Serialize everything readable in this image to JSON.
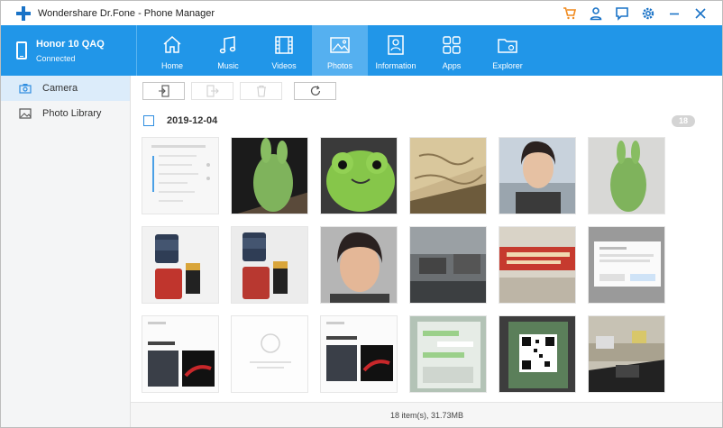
{
  "app": {
    "title": "Wondershare Dr.Fone - Phone Manager"
  },
  "title_icons": [
    "cart-icon",
    "user-icon",
    "feedback-icon",
    "settings-icon",
    "minimize-icon",
    "close-icon"
  ],
  "device": {
    "name": "Honor 10 QAQ",
    "status": "Connected"
  },
  "tabs": [
    {
      "label": "Home",
      "icon": "home-icon",
      "active": false
    },
    {
      "label": "Music",
      "icon": "music-icon",
      "active": false
    },
    {
      "label": "Videos",
      "icon": "film-icon",
      "active": false
    },
    {
      "label": "Photos",
      "icon": "photo-icon",
      "active": true
    },
    {
      "label": "Information",
      "icon": "contact-card-icon",
      "active": false
    },
    {
      "label": "Apps",
      "icon": "apps-grid-icon",
      "active": false
    },
    {
      "label": "Explorer",
      "icon": "folder-icon",
      "active": false
    }
  ],
  "sidebar": {
    "items": [
      {
        "label": "Camera",
        "icon": "camera-icon",
        "active": true
      },
      {
        "label": "Photo Library",
        "icon": "image-icon",
        "active": false
      }
    ]
  },
  "toolbar": {
    "buttons": [
      {
        "name": "import-button",
        "icon": "import-icon",
        "enabled": true
      },
      {
        "name": "export-button",
        "icon": "export-icon",
        "enabled": false
      },
      {
        "name": "delete-button",
        "icon": "trash-icon",
        "enabled": false
      },
      {
        "name": "refresh-button",
        "icon": "refresh-icon",
        "enabled": true
      }
    ]
  },
  "group": {
    "date": "2019-12-04",
    "count": "18"
  },
  "photos": [
    "phone screenshot",
    "green toy",
    "green frog toy",
    "map on wall",
    "portrait",
    "green toy",
    "bottles",
    "bottles",
    "portrait",
    "office",
    "office sign",
    "phone screenshot",
    "phone screenshot",
    "phone screenshot",
    "phone screenshot",
    "phone screenshot",
    "qr code",
    "devices"
  ],
  "status": {
    "text": "18 item(s), 31.73MB"
  },
  "colors": {
    "accent": "#2196e8",
    "active_tab": "#55b0f0",
    "sidebar_active": "#dcecfa"
  }
}
